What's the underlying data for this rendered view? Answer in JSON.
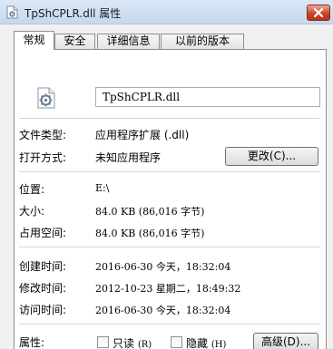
{
  "window": {
    "title": "TpShCPLR.dll 属性",
    "icon": "dll-file-icon",
    "close_icon": "close-icon"
  },
  "tabs": [
    "常规",
    "安全",
    "详细信息",
    "以前的版本"
  ],
  "general": {
    "file_name": "TpShCPLR.dll",
    "file_type": {
      "label": "文件类型:",
      "value": "应用程序扩展 (.dll)"
    },
    "opens_with": {
      "label": "打开方式:",
      "value": "未知应用程序",
      "button": "更改(C)..."
    },
    "location": {
      "label": "位置:",
      "value": "E:\\"
    },
    "size": {
      "label": "大小:",
      "value": "84.0 KB (86,016 字节)"
    },
    "size_on_disk": {
      "label": "占用空间:",
      "value": "84.0 KB (86,016 字节)"
    },
    "created": {
      "label": "创建时间:",
      "value": "2016-06-30 今天，18:32:04"
    },
    "modified": {
      "label": "修改时间:",
      "value": "2012-10-23 星期二，18:49:32"
    },
    "accessed": {
      "label": "访问时间:",
      "value": "2016-06-30 今天，18:32:04"
    },
    "attributes": {
      "label": "属性:",
      "read_only": {
        "text": "只读",
        "key": "(R)",
        "checked": false
      },
      "hidden": {
        "text": "隐藏",
        "key": "(H)",
        "checked": false
      },
      "advanced_button": "高级(D)..."
    }
  }
}
